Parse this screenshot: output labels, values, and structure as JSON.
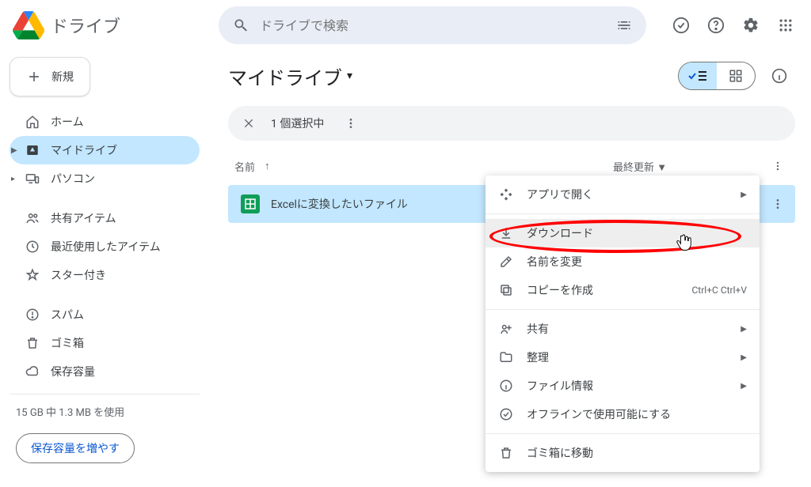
{
  "header": {
    "product": "ドライブ",
    "search_placeholder": "ドライブで検索"
  },
  "sidebar": {
    "new_label": "新規",
    "items": [
      {
        "label": "ホーム"
      },
      {
        "label": "マイドライブ"
      },
      {
        "label": "パソコン"
      },
      {
        "label": "共有アイテム"
      },
      {
        "label": "最近使用したアイテム"
      },
      {
        "label": "スター付き"
      },
      {
        "label": "スパム"
      },
      {
        "label": "ゴミ箱"
      },
      {
        "label": "保存容量"
      }
    ],
    "storage_text": "15 GB 中 1.3 MB を使用",
    "storage_btn": "保存容量を増やす"
  },
  "main": {
    "title": "マイドライブ",
    "selection_text": "1 個選択中",
    "columns": {
      "name": "名前",
      "modified": "最終更新 ▼"
    },
    "file": {
      "name": "Excelに変換したいファイル"
    }
  },
  "context_menu": {
    "open_with": "アプリで開く",
    "download": "ダウンロード",
    "rename": "名前を変更",
    "copy": "コピーを作成",
    "copy_shortcut": "Ctrl+C Ctrl+V",
    "share": "共有",
    "organize": "整理",
    "file_info": "ファイル情報",
    "offline": "オフラインで使用可能にする",
    "trash": "ゴミ箱に移動"
  }
}
